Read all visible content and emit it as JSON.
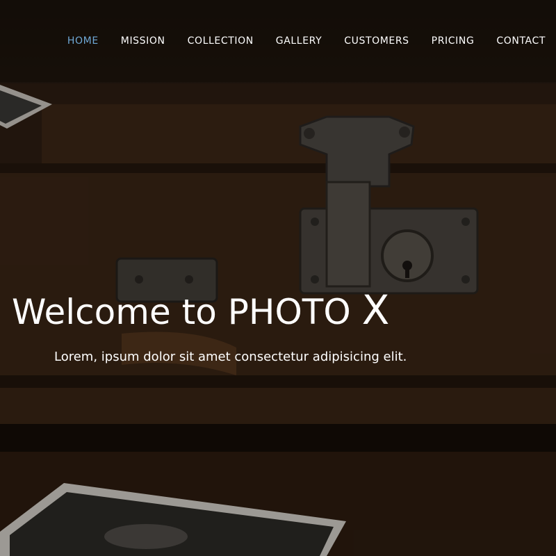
{
  "nav": {
    "items": [
      {
        "label": "HOME",
        "active": true
      },
      {
        "label": "MISSION",
        "active": false
      },
      {
        "label": "COLLECTION",
        "active": false
      },
      {
        "label": "GALLERY",
        "active": false
      },
      {
        "label": "CUSTOMERS",
        "active": false
      },
      {
        "label": "PRICING",
        "active": false
      },
      {
        "label": "CONTACT",
        "active": false
      }
    ]
  },
  "hero": {
    "title_main": "Welcome to PHOTO ",
    "title_accent": "X",
    "subtitle": "Lorem, ipsum dolor sit amet consectetur adipisicing elit."
  },
  "colors": {
    "active_nav": "#6fa8d6",
    "text": "#ffffff",
    "background": "#2b1d13"
  }
}
